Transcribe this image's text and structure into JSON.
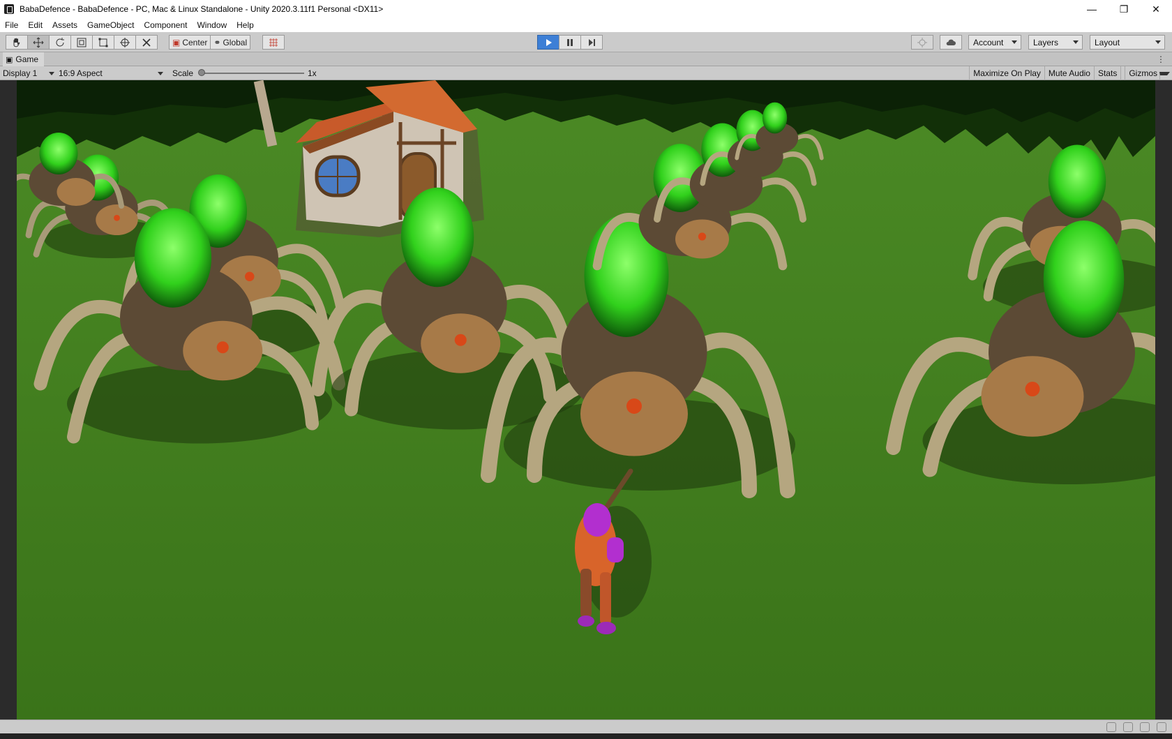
{
  "window": {
    "title": "BabaDefence - BabaDefence - PC, Mac & Linux Standalone - Unity 2020.3.11f1 Personal <DX11>",
    "controls": [
      "minimize-icon",
      "restore-icon",
      "close-icon"
    ]
  },
  "menu": {
    "items": [
      "File",
      "Edit",
      "Assets",
      "GameObject",
      "Component",
      "Window",
      "Help"
    ]
  },
  "toolbar": {
    "tools": [
      "hand-tool-icon",
      "move-tool-icon",
      "rotate-tool-icon",
      "scale-tool-icon",
      "rect-tool-icon",
      "transform-tool-icon",
      "custom-tool-icon"
    ],
    "pivot_label": "Center",
    "space_label": "Global",
    "grid_snap": "grid-snap-icon",
    "play": "play-icon",
    "pause": "pause-icon",
    "step": "step-icon",
    "collab": "collab-icon",
    "cloud": "cloud-icon",
    "account_label": "Account",
    "layers_label": "Layers",
    "layout_label": "Layout",
    "play_color": "#3d7fd6"
  },
  "tab": {
    "label": "Game",
    "menu": "⋮"
  },
  "gamebar": {
    "display": "Display 1",
    "aspect": "16:9 Aspect",
    "scale_label": "Scale",
    "scale_value": "1x",
    "scale_level": 0,
    "maximize": "Maximize On Play",
    "mute": "Mute Audio",
    "stats": "Stats",
    "gizmos": "Gizmos"
  },
  "scene": {
    "grass_color": "#3f7a1c",
    "tree_color": "#0f2a0a",
    "spider_glow": "#3de02a",
    "hero_color": "#d8642a",
    "hero_accent": "#b22fcf"
  },
  "status": {
    "icons": [
      "bug-icon",
      "layers-status-icon",
      "network-icon",
      "settings-icon"
    ]
  }
}
